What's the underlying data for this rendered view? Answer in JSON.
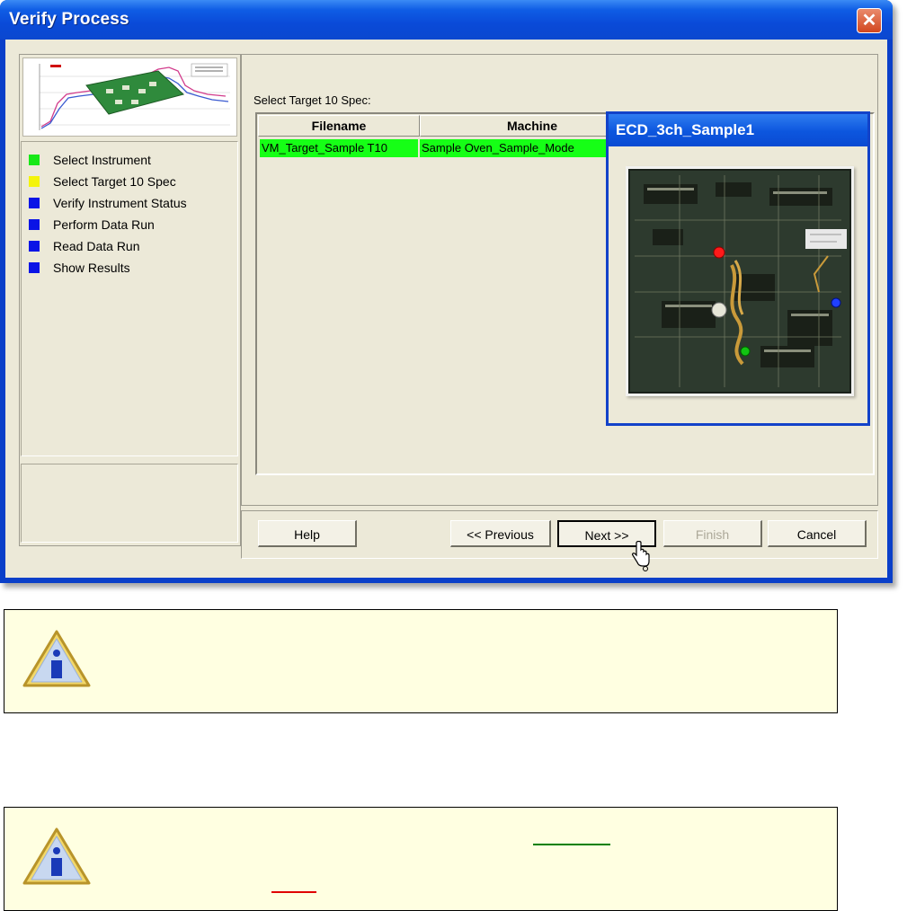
{
  "window": {
    "title": "Verify Process",
    "close_glyph": "✕"
  },
  "steps": [
    {
      "label": "Select Instrument",
      "color": "#17e817"
    },
    {
      "label": "Select Target 10 Spec",
      "color": "#f4f40a"
    },
    {
      "label": "Verify Instrument Status",
      "color": "#0a14e6"
    },
    {
      "label": "Perform Data Run",
      "color": "#0a14e6"
    },
    {
      "label": "Read Data Run",
      "color": "#0a14e6"
    },
    {
      "label": "Show Results",
      "color": "#0a14e6"
    }
  ],
  "main": {
    "select_label": "Select Target 10 Spec:",
    "columns": [
      "Filename",
      "Machine"
    ],
    "rows": [
      {
        "filename": "VM_Target_Sample T10",
        "machine": "Sample Oven_Sample_Mode",
        "selected": true
      }
    ]
  },
  "preview": {
    "title": "ECD_3ch_Sample1"
  },
  "buttons": {
    "help": "Help",
    "previous": "<< Previous",
    "next": "Next >>",
    "finish": "Finish",
    "cancel": "Cancel"
  },
  "notes": [
    {
      "icon": "info-caution-icon"
    },
    {
      "icon": "info-caution-icon"
    }
  ],
  "colors": {
    "title_bar": "#0a4ad8",
    "selected_row": "#16ff16",
    "note_background": "#ffffe1",
    "link_green": "#008000",
    "link_red": "#e00000"
  }
}
